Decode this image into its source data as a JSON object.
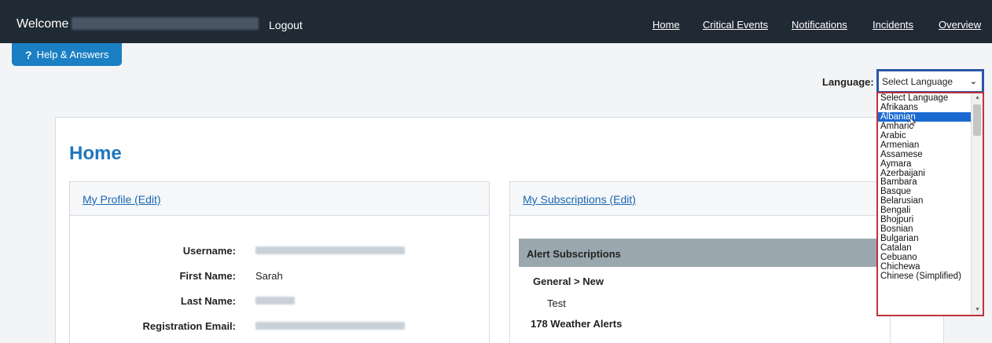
{
  "header": {
    "welcome": "Welcome",
    "logout": "Logout",
    "nav": [
      "Home",
      "Critical Events",
      "Notifications",
      "Incidents",
      "Overview"
    ]
  },
  "help": {
    "icon": "?",
    "label": "Help & Answers"
  },
  "language": {
    "label": "Language:",
    "selected": "Select Language",
    "highlighted": "Albanian",
    "options": [
      "Select Language",
      "Afrikaans",
      "Albanian",
      "Amharic",
      "Arabic",
      "Armenian",
      "Assamese",
      "Aymara",
      "Azerbaijani",
      "Bambara",
      "Basque",
      "Belarusian",
      "Bengali",
      "Bhojpuri",
      "Bosnian",
      "Bulgarian",
      "Catalan",
      "Cebuano",
      "Chichewa",
      "Chinese (Simplified)"
    ]
  },
  "page": {
    "title": "Home"
  },
  "profile": {
    "title": "My Profile (Edit)",
    "username_label": "Username:",
    "first_name_label": "First Name:",
    "first_name": "Sarah",
    "last_name_label": "Last Name:",
    "reg_email_label": "Registration Email:"
  },
  "subscriptions": {
    "title": "My Subscriptions (Edit)",
    "alert_header": "Alert Subscriptions",
    "items": [
      "General > New",
      "Test",
      "178 Weather Alerts"
    ]
  },
  "colors": {
    "topbar": "#202a35",
    "accent": "#1b7fc4",
    "selected_option": "#1a69d1",
    "dropdown_border": "#c0323b"
  }
}
